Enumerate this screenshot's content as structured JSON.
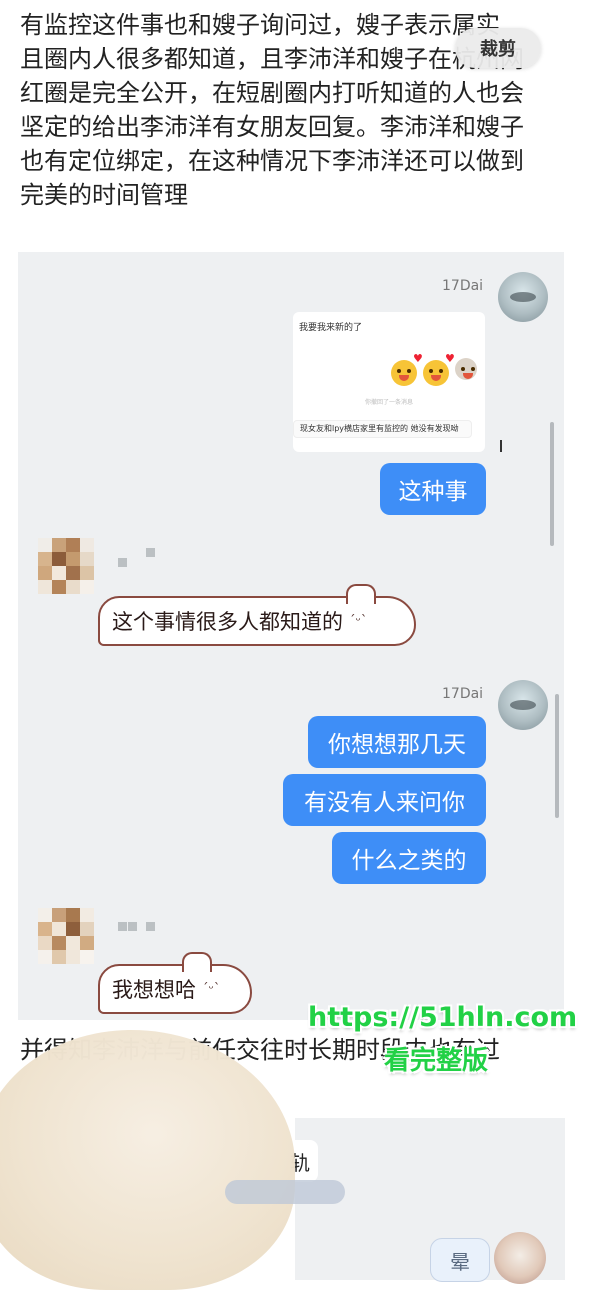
{
  "article": {
    "lines": [
      "有监控这件事也和嫂子询问过，嫂子表示属实",
      "且圈内人很多都知道，且李沛洋和嫂子在杭州网",
      "红圈是完全公开，在短剧圈内打听知道的人也会",
      "坚定的给出李沛洋有女朋友回复。李沛洋和嫂子",
      "也有定位绑定，在这种情况下李沛洋还可以做到",
      "完美的时间管理"
    ],
    "crop_label": "裁剪"
  },
  "chat": {
    "self_name": "17Dai",
    "embedded": {
      "line1": "我要我来新的了",
      "recall": "你撤回了一条消息",
      "line3": "现女友和lpy横店家里有监控的 她没有发现呦"
    },
    "messages": [
      {
        "side": "right",
        "text": "这种事"
      },
      {
        "side": "left",
        "text": "这个事情很多人都知道的"
      },
      {
        "side": "right",
        "text": "你想想那几天"
      },
      {
        "side": "right",
        "text": "有没有人来问你"
      },
      {
        "side": "right",
        "text": "什么之类的"
      },
      {
        "side": "left",
        "text": "我想想哈"
      }
    ],
    "bubble_face": "ˊᵕˋ"
  },
  "bottom": {
    "text": "并得知李沛洋与前任交往时长期时段内也有过",
    "chat_fragment": "轨",
    "bubble_text": "晕"
  },
  "watermark": {
    "url": "https://51hln.com",
    "cta": "看完整版"
  },
  "colors": {
    "bubble_blue": "#3e8ef7",
    "chat_bg": "#eef0f2",
    "watermark_green": "#22d146"
  }
}
